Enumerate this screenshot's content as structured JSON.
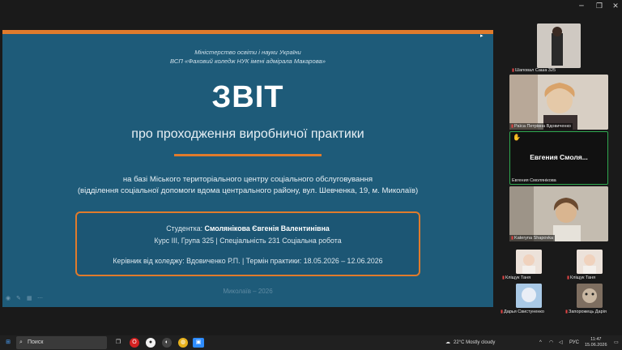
{
  "window": {
    "minimize_label": "─",
    "maximize_label": "❐",
    "close_label": "✕"
  },
  "slide": {
    "ministry_line1": "Міністерство освіти і науки України",
    "ministry_line2": "ВСП «Фаховий коледж НУК імені адмірала Макарова»",
    "title": "ЗВІТ",
    "subtitle": "про проходження виробничої практики",
    "base_line1": "на базі Міського територіального центру соціального обслуговування",
    "base_line2": "(відділення соціальної допомоги вдома центрального району, вул. Шевченка, 19, м. Миколаїв)",
    "student_prefix": "Студентка:",
    "student_name": "Смолянікова  Євгенія Валентинівна",
    "course_line": "Курс III, Група 325   |   Спеціальність 231 Соціальна робота",
    "supervisor_line": "Керівник від коледжу: Вдовиченко Р.П.   |   Термін практики: 18.05.2026 – 12.06.2026",
    "city_line": "Миколаїв – 2026",
    "accent_color": "#e07b2c",
    "background_color": "#1e5b79"
  },
  "participants": {
    "p1_name": "Шаповал Саша 325",
    "p2_name": "Раїса Петрівна Вдовиченко",
    "p3_display": "Евгения  Смоля...",
    "p3_name": "Евгения Смолянікова",
    "p3_hand_icon": "✋",
    "p4_name": "Kateryna Shapovka",
    "p5_name": "Кліщук Таня",
    "p6_name": "Кліщук Таня",
    "p7_name": "Дарья Свистуненко",
    "p8_name": "Запорожець Дарія"
  },
  "taskbar": {
    "search_placeholder": "Поиск",
    "weather": "22°C  Mostly cloudy",
    "language": "РУС",
    "time": "11:47",
    "date": "15.06.2026"
  }
}
